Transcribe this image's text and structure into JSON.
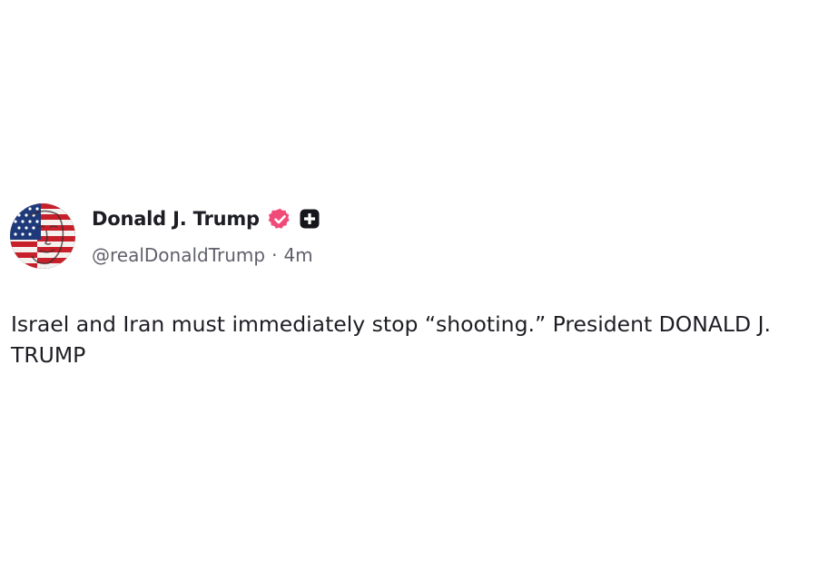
{
  "post": {
    "author": {
      "display_name": "Donald J. Trump",
      "handle": "@realDonaldTrump",
      "avatar_icon": "flag-face-avatar",
      "verified_icon": "verified-badge-icon",
      "verified_color": "#f04b78",
      "extra_badge_icon": "plus-badge-icon",
      "extra_badge_color": "#15151c"
    },
    "separator": "·",
    "timestamp": "4m",
    "body_text": "Israel and Iran must immediately stop “shooting.” President DONALD J. TRUMP"
  }
}
